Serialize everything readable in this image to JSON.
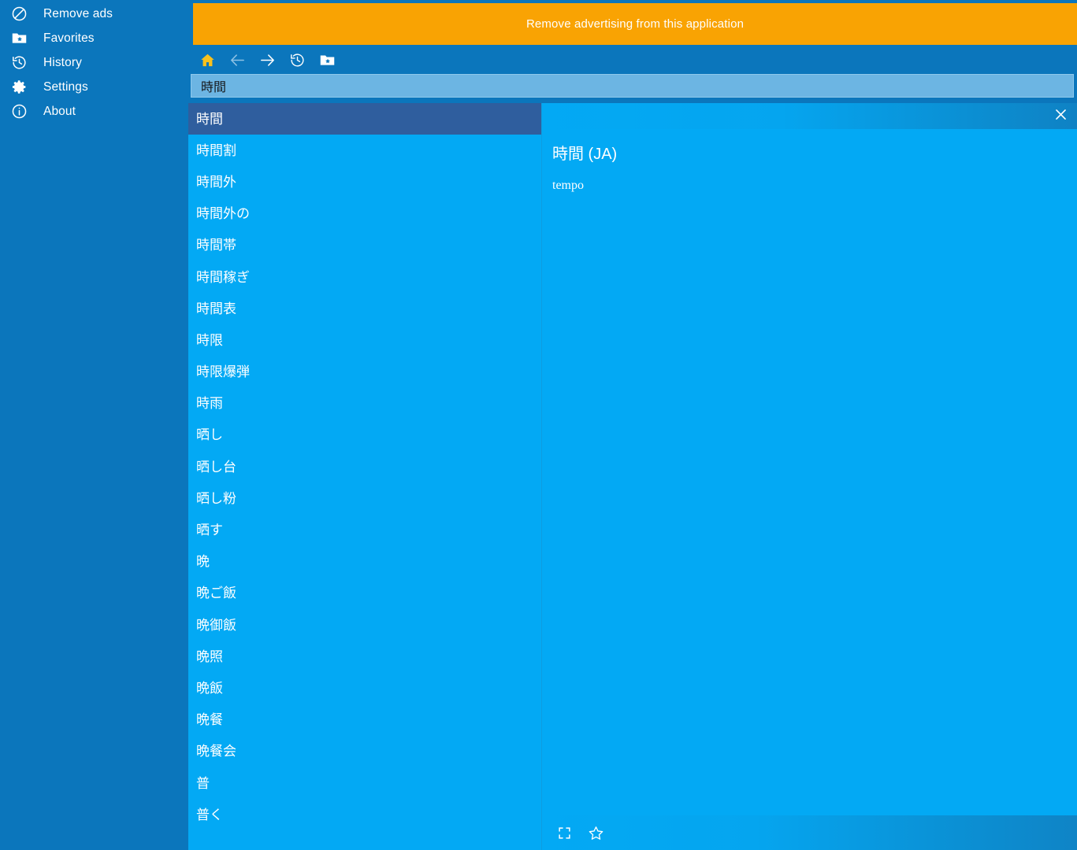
{
  "sidebar": {
    "items": [
      {
        "label": "Remove ads",
        "icon": "block-circle-icon",
        "name": "remove-ads"
      },
      {
        "label": "Favorites",
        "icon": "folder-star-icon",
        "name": "favorites"
      },
      {
        "label": "History",
        "icon": "history-clock-icon",
        "name": "history"
      },
      {
        "label": "Settings",
        "icon": "gear-icon",
        "name": "settings"
      },
      {
        "label": "About",
        "icon": "info-circle-icon",
        "name": "about"
      }
    ]
  },
  "ad_banner": {
    "text": "Remove advertising from this application",
    "background": "#f9a303"
  },
  "toolbar": {
    "buttons": [
      {
        "name": "home-button",
        "icon": "home-icon",
        "state": "active"
      },
      {
        "name": "back-button",
        "icon": "arrow-left-icon",
        "state": "disabled"
      },
      {
        "name": "forward-button",
        "icon": "arrow-right-icon",
        "state": "enabled"
      },
      {
        "name": "history-button",
        "icon": "history-clock-icon",
        "state": "enabled"
      },
      {
        "name": "favorites-button",
        "icon": "folder-star-icon",
        "state": "enabled"
      }
    ],
    "home_icon_color": "#f9c11c",
    "disabled_icon_color": "#8fc2e4"
  },
  "search": {
    "value": "時間",
    "placeholder": ""
  },
  "word_list": {
    "selected_index": 0,
    "items": [
      "時間",
      "時間割",
      "時間外",
      "時間外の",
      "時間帯",
      "時間稼ぎ",
      "時間表",
      "時限",
      "時限爆弾",
      "時雨",
      "晒し",
      "晒し台",
      "晒し粉",
      "晒す",
      "晩",
      "晩ご飯",
      "晩御飯",
      "晩照",
      "晩飯",
      "晩餐",
      "晩餐会",
      "普",
      "普く"
    ]
  },
  "definition": {
    "title": "時間 (JA)",
    "body": "tempo",
    "close_label": "✕"
  },
  "definition_footer": {
    "buttons": [
      {
        "name": "fullscreen-button",
        "icon": "fullscreen-icon"
      },
      {
        "name": "favorite-button",
        "icon": "star-outline-icon"
      }
    ]
  },
  "colors": {
    "sidebar": "#0b76bc",
    "list": "#03a9f4",
    "selected": "#2f5e9e",
    "accent_orange": "#f9a303",
    "search_field": "#6cb5e3"
  }
}
